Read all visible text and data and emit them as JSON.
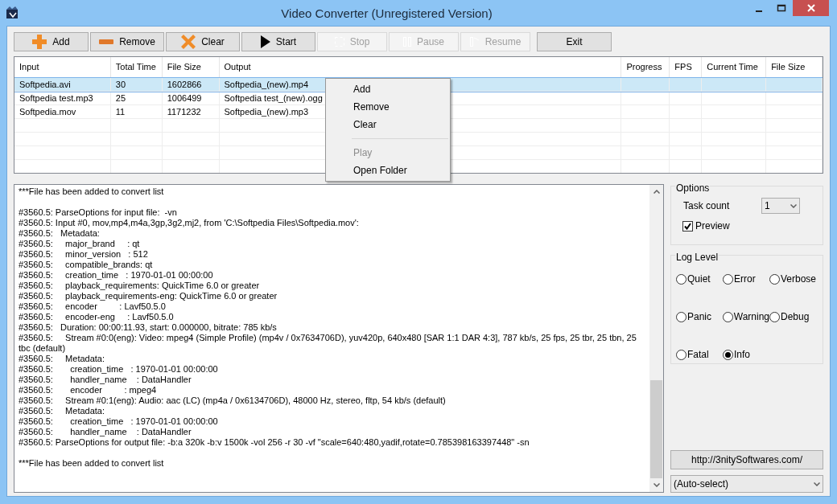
{
  "window": {
    "title": "Video Converter  (Unregistered Version)"
  },
  "toolbar": [
    {
      "label": "Add",
      "disabled": false
    },
    {
      "label": "Remove",
      "disabled": false
    },
    {
      "label": "Clear",
      "disabled": false
    },
    {
      "label": "Start",
      "disabled": false
    },
    {
      "label": "Stop",
      "disabled": true
    },
    {
      "label": "Pause",
      "disabled": true
    },
    {
      "label": "Resume",
      "disabled": true
    },
    {
      "label": "Exit",
      "disabled": false
    }
  ],
  "table": {
    "columns": [
      "Input",
      "Total Time",
      "File Size",
      "Output",
      "Progress",
      "FPS",
      "Current Time",
      "File Size"
    ],
    "rows": [
      {
        "cells": [
          "Softpedia.avi",
          "30",
          "1602866",
          "Softpedia_(new).mp4"
        ],
        "selected": true
      },
      {
        "cells": [
          "Softpedia test.mp3",
          "25",
          "1006499",
          "Softpedia test_(new).ogg"
        ],
        "selected": false
      },
      {
        "cells": [
          "Softpedia.mov",
          "11",
          "1171232",
          "Softpedia_(new).mp3"
        ],
        "selected": false
      }
    ]
  },
  "context_menu": [
    {
      "kind": "item",
      "label": "Add",
      "disabled": false
    },
    {
      "kind": "item",
      "label": "Remove",
      "disabled": false
    },
    {
      "kind": "item",
      "label": "Clear",
      "disabled": false
    },
    {
      "kind": "separator"
    },
    {
      "kind": "item",
      "label": "Play",
      "disabled": true
    },
    {
      "kind": "item",
      "label": "Open Folder",
      "disabled": false
    }
  ],
  "log": [
    {
      "lines": [
        "***File has been added to convert list"
      ]
    },
    {
      "lines": [
        "#3560.5: ParseOptions for input file:  -vn",
        "#3560.5: Input #0, mov,mp4,m4a,3gp,3g2,mj2, from 'C:\\Softpedia Files\\Softpedia.mov':",
        "#3560.5:   Metadata:",
        "#3560.5:     major_brand     : qt",
        "#3560.5:     minor_version   : 512",
        "#3560.5:     compatible_brands: qt",
        "#3560.5:     creation_time   : 1970-01-01 00:00:00",
        "#3560.5:     playback_requirements: QuickTime 6.0 or greater",
        "#3560.5:     playback_requirements-eng: QuickTime 6.0 or greater",
        "#3560.5:     encoder         : Lavf50.5.0",
        "#3560.5:     encoder-eng     : Lavf50.5.0",
        "#3560.5:   Duration: 00:00:11.93, start: 0.000000, bitrate: 785 kb/s",
        "#3560.5:     Stream #0:0(eng): Video: mpeg4 (Simple Profile) (mp4v / 0x7634706D), yuv420p, 640x480 [SAR 1:1 DAR 4:3], 787 kb/s, 25 fps, 25 tbr, 25 tbn, 25 tbc (default)",
        "#3560.5:     Metadata:",
        "#3560.5:       creation_time   : 1970-01-01 00:00:00",
        "#3560.5:       handler_name    : DataHandler",
        "#3560.5:       encoder         : mpeg4",
        "#3560.5:     Stream #0:1(eng): Audio: aac (LC) (mp4a / 0x6134706D), 48000 Hz, stereo, fltp, 54 kb/s (default)",
        "#3560.5:     Metadata:",
        "#3560.5:       creation_time   : 1970-01-01 00:00:00",
        "#3560.5:       handler_name    : DataHandler",
        "#3560.5: ParseOptions for output file: -b:a 320k -b:v 1500k -vol 256 -r 30 -vf \"scale=640:480,yadif,rotate=0.785398163397448\" -sn"
      ]
    },
    {
      "lines": [
        "***File has been added to convert list"
      ]
    }
  ],
  "options": {
    "title": "Options",
    "task_count_label": "Task count",
    "task_count": "1",
    "preview": {
      "label": "Preview",
      "checked": true
    }
  },
  "log_level": {
    "title": "Log Level",
    "options": [
      {
        "label": "Quiet",
        "selected": false
      },
      {
        "label": "Error",
        "selected": false
      },
      {
        "label": "Verbose",
        "selected": false
      },
      {
        "label": "Panic",
        "selected": false
      },
      {
        "label": "Warning",
        "selected": false
      },
      {
        "label": "Debug",
        "selected": false
      },
      {
        "label": "Fatal",
        "selected": false
      },
      {
        "label": "Info",
        "selected": true
      }
    ]
  },
  "website_button": "http://3nitySoftwares.com/",
  "device_select": "(Auto-select)"
}
